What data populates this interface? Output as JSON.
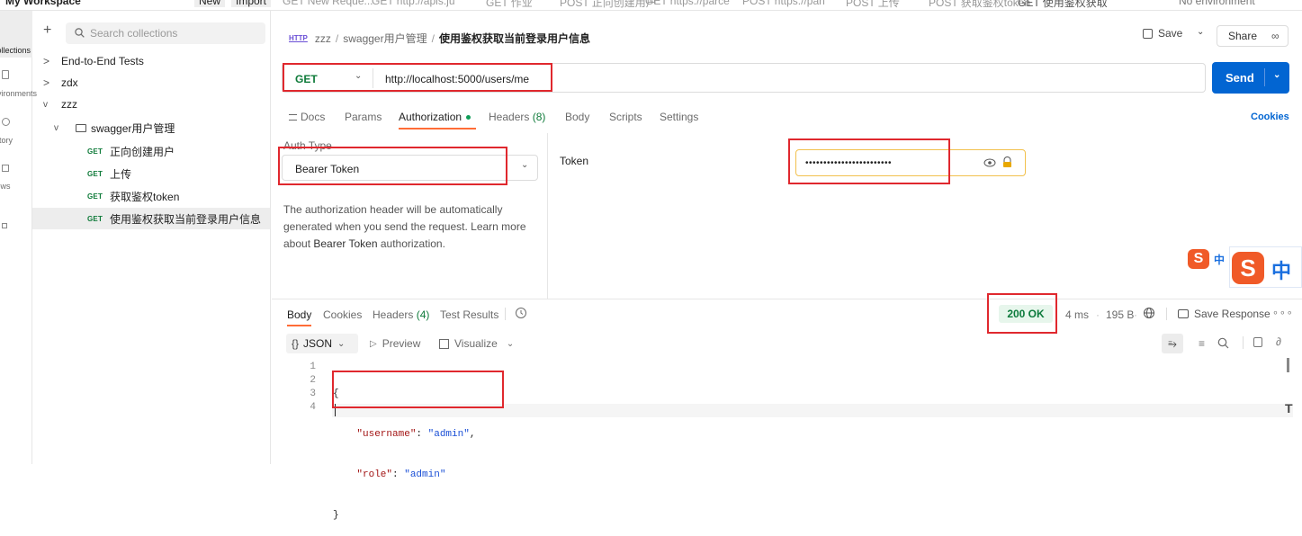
{
  "topbar": {
    "workspace": "My Workspace",
    "new_label": "New",
    "import_label": "Import",
    "environment": "No environment",
    "tabs": [
      "GET New Reque...",
      "GET http://apis.ju",
      "GET 作业",
      "POST 正向创建用户",
      "GET https://parce",
      "POST https://pan",
      "POST 上传",
      "POST 获取鉴权token",
      "GET 使用鉴权获取"
    ]
  },
  "rail": [
    "Collections",
    "Environments",
    "History",
    "Flows"
  ],
  "sidebar": {
    "search_placeholder": "Search collections",
    "tree": [
      {
        "label": "End-to-End Tests",
        "chevron": ">"
      },
      {
        "label": "zdx",
        "chevron": ">"
      },
      {
        "label": "zzz",
        "chevron": "v"
      },
      {
        "label": "swagger用户管理",
        "chevron": "v"
      }
    ],
    "requests": [
      {
        "method": "GET",
        "label": "正向创建用户"
      },
      {
        "method": "GET",
        "label": "上传"
      },
      {
        "method": "GET",
        "label": "获取鉴权token"
      },
      {
        "method": "GET",
        "label": "使用鉴权获取当前登录用户信息"
      }
    ]
  },
  "request": {
    "breadcrumb_root": "zzz",
    "breadcrumb_folder": "swagger用户管理",
    "breadcrumb_current": "使用鉴权获取当前登录用户信息",
    "save_label": "Save",
    "share_label": "Share",
    "method": "GET",
    "url": "http://localhost:5000/users/me",
    "send_label": "Send",
    "tabs": {
      "docs": "Docs",
      "params": "Params",
      "authorization": "Authorization",
      "headers": "Headers",
      "headers_count": "(8)",
      "body": "Body",
      "scripts": "Scripts",
      "settings": "Settings"
    },
    "cookies_label": "Cookies"
  },
  "auth": {
    "type_label": "Auth Type",
    "type_value": "Bearer Token",
    "description_1": "The authorization header will be automatically",
    "description_2": "generated when you send the request. Learn more",
    "description_3_prefix": "about ",
    "description_link": "Bearer Token",
    "description_3_suffix": " authorization.",
    "token_label": "Token",
    "token_value": "••••••••••••••••••••••••"
  },
  "ime": {
    "glyph": "中"
  },
  "response": {
    "tabs": {
      "body": "Body",
      "cookies": "Cookies",
      "headers": "Headers",
      "headers_count": "(4)",
      "test_results": "Test Results"
    },
    "status": "200 OK",
    "time": "4 ms",
    "size": "195 B",
    "save_response": "Save Response",
    "format": "JSON",
    "preview_label": "Preview",
    "visualize_label": "Visualize",
    "lines": [
      {
        "num": "1",
        "text": "{"
      },
      {
        "num": "2",
        "key": "\"username\"",
        "sep": ": ",
        "value": "\"admin\"",
        "end": ","
      },
      {
        "num": "3",
        "key": "\"role\"",
        "sep": ": ",
        "value": "\"admin\"",
        "end": ""
      },
      {
        "num": "4",
        "text": "}"
      }
    ]
  },
  "colors": {
    "accent_orange": "#ff6c37",
    "send_blue": "#0265d2",
    "method_green": "#0f7b3a",
    "highlight_red": "#e0282e",
    "status_green": "#0b7a3b",
    "json_key": "#a31515",
    "json_value": "#1a4fd6"
  }
}
